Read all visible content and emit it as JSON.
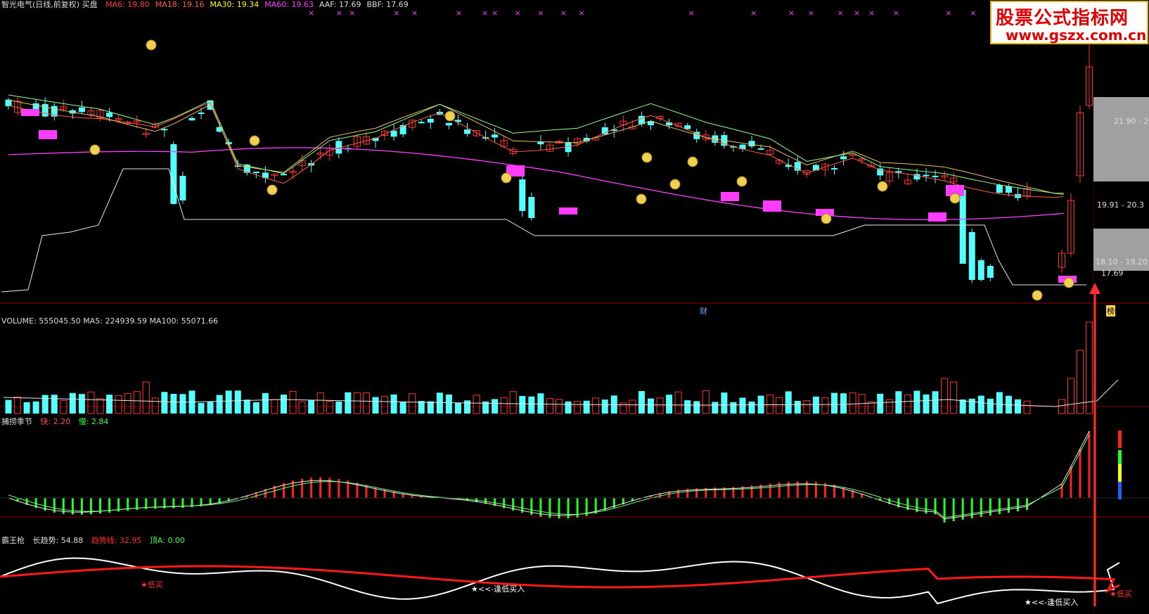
{
  "main": {
    "title": "智光电气(日线,前复权) 买盘",
    "indicators": [
      {
        "label": "MA6: 19.80",
        "color": "#ff4040"
      },
      {
        "label": "MA18: 19.16",
        "color": "#ff6040"
      },
      {
        "label": "MA30: 19.34",
        "color": "#ffff00"
      },
      {
        "label": "MA60: 19.63",
        "color": "#ff40ff"
      },
      {
        "label": "AAF: 17.69",
        "color": "#dddddd"
      },
      {
        "label": "BBF: 17.69",
        "color": "#dddddd"
      }
    ],
    "price_labels": [
      "21.90 - 2",
      "19.91 - 20.3",
      "18.10 - 19.20",
      "17.69"
    ],
    "markers": {
      "cai": "财",
      "bang": "榜"
    }
  },
  "volume": {
    "label": "VOLUME: 555045.50  MA5: 224939.59  MA100: 55071.66"
  },
  "season": {
    "name": "捕捞季节",
    "fast": "快: 2.20",
    "slow": "慢: 2.84"
  },
  "bawang": {
    "name": "霸王枪",
    "long_trend": "长趋势: 54.88",
    "trend_line": "趋势线: 32.95",
    "top": "顶A: 0.00",
    "signals": [
      "★低买",
      "★<<-逢低买入",
      "★<<-逢低买入",
      "★低买"
    ]
  },
  "watermark": {
    "line1": "股票公式指标网",
    "line2": "www.gszx.com.cn"
  },
  "colors": {
    "up": "#ff3232",
    "down": "#54ffff",
    "macd_up": "#ff2020",
    "macd_down": "#20ff20",
    "ma60": "#ff40ff",
    "magenta_box": "#ff3cff"
  }
}
